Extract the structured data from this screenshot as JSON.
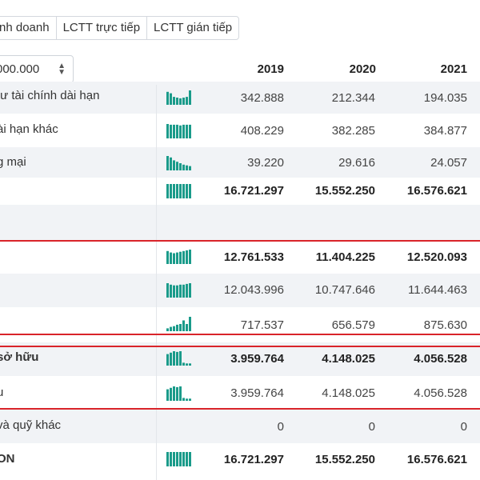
{
  "tabs": [
    "nh doanh",
    "LCTT trực tiếp",
    "LCTT gián tiếp"
  ],
  "unit_select": {
    "value": "000.000",
    "arrows_icon": "up-down-caret-icon"
  },
  "years": [
    "2019",
    "2020",
    "2021"
  ],
  "colors": {
    "sparkline": "#1a9b8a",
    "highlight_border": "#d9242a",
    "row_shade": "#f1f3f6"
  },
  "rows": [
    {
      "label": "tư tài chính dài hạn",
      "bold": false,
      "spark": [
        0.9,
        0.8,
        0.55,
        0.5,
        0.45,
        0.5,
        0.55,
        1.0
      ],
      "values": [
        "342.888",
        "212.344",
        "194.035"
      ]
    },
    {
      "label": "ài hạn khác",
      "bold": false,
      "spark": [
        1.0,
        0.95,
        0.95,
        0.95,
        0.9,
        0.95,
        0.95,
        0.95
      ],
      "values": [
        "408.229",
        "382.285",
        "384.877"
      ]
    },
    {
      "label": "g mại",
      "bold": false,
      "spark": [
        1.0,
        0.9,
        0.7,
        0.6,
        0.5,
        0.4,
        0.35,
        0.3
      ],
      "values": [
        "39.220",
        "29.616",
        "24.057"
      ]
    },
    {
      "label": "",
      "bold": true,
      "spark": [
        1.0,
        1.0,
        1.0,
        1.0,
        1.0,
        1.0,
        1.0,
        1.0
      ],
      "values": [
        "16.721.297",
        "15.552.250",
        "16.576.621"
      ]
    },
    {
      "label": "",
      "bold": false,
      "spark": [],
      "values": [
        "",
        "",
        ""
      ]
    },
    {
      "label": "",
      "bold": true,
      "spark": [
        0.9,
        0.8,
        0.75,
        0.8,
        0.85,
        0.9,
        0.95,
        1.0
      ],
      "values": [
        "12.761.533",
        "11.404.225",
        "12.520.093"
      ]
    },
    {
      "label": "",
      "bold": false,
      "spark": [
        1.0,
        0.9,
        0.85,
        0.85,
        0.9,
        0.9,
        0.95,
        1.0
      ],
      "values": [
        "12.043.996",
        "10.747.646",
        "11.644.463"
      ]
    },
    {
      "label": "",
      "bold": false,
      "spark": [
        0.2,
        0.3,
        0.35,
        0.45,
        0.5,
        0.75,
        0.5,
        1.0
      ],
      "values": [
        "717.537",
        "656.579",
        "875.630"
      ]
    },
    {
      "label": "sở hữu",
      "bold": true,
      "spark": [
        0.8,
        0.9,
        1.0,
        0.95,
        1.0,
        0.2,
        0.15,
        0.15
      ],
      "values": [
        "3.959.764",
        "4.148.025",
        "4.056.528"
      ]
    },
    {
      "label": "u",
      "bold": false,
      "spark": [
        0.8,
        0.9,
        1.0,
        0.95,
        1.0,
        0.2,
        0.15,
        0.15
      ],
      "values": [
        "3.959.764",
        "4.148.025",
        "4.056.528"
      ]
    },
    {
      "label": "và quỹ khác",
      "bold": false,
      "spark": [],
      "values": [
        "0",
        "0",
        "0"
      ]
    },
    {
      "label": "ON",
      "bold": true,
      "spark": [
        1.0,
        1.0,
        1.0,
        1.0,
        1.0,
        1.0,
        1.0,
        1.0
      ],
      "values": [
        "16.721.297",
        "15.552.250",
        "16.576.621"
      ]
    }
  ]
}
